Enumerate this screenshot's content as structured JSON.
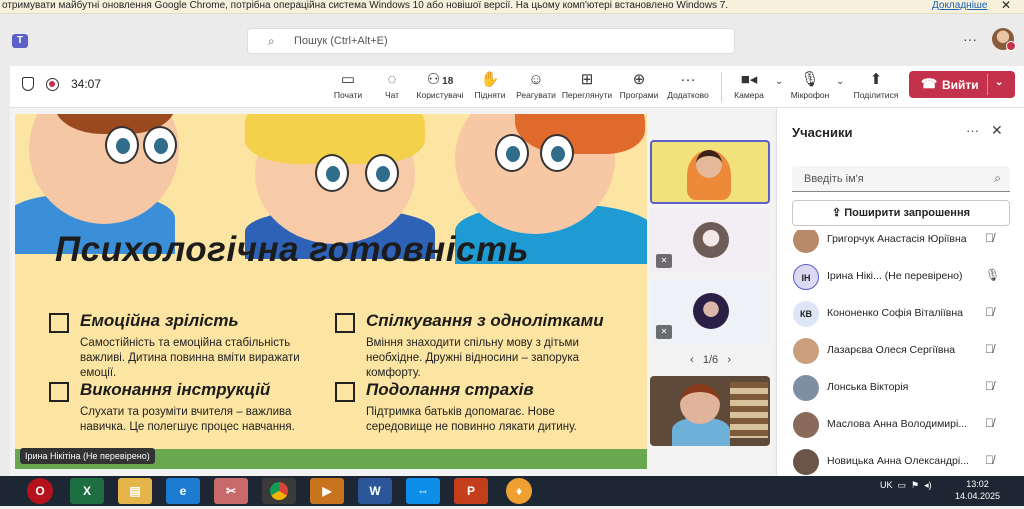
{
  "banner": {
    "text": "отримувати майбутні оновлення Google Chrome, потрібна операційна система Windows 10 або новішої версії. На цьому комп'ютері встановлено Windows 7.",
    "more": "Докладніше",
    "close": "✕"
  },
  "topbar": {
    "search_placeholder": "Пошук (Ctrl+Alt+E)",
    "menu": "···"
  },
  "call": {
    "timer": "34:07",
    "leave_label": "Вийти"
  },
  "toolbar": {
    "start": "Почати",
    "chat": "Чат",
    "people": "Користувачі",
    "people_count": "18",
    "raise": "Підняти",
    "react": "Реагувати",
    "view": "Переглянути",
    "apps": "Програми",
    "more": "Додатково",
    "camera": "Камера",
    "mic": "Мікрофон",
    "share": "Поділитися"
  },
  "slide": {
    "title": "Психологічна готовність",
    "items": [
      {
        "heading": "Емоційна зрілість",
        "text": "Самостійність та емоційна стабільність важливі. Дитина повинна вміти виражати емоції."
      },
      {
        "heading": "Спілкування з однолітками",
        "text": "Вміння знаходити спільну мову з дітьми необхідне. Дружні відносини – запорука комфорту."
      },
      {
        "heading": "Виконання інструкцій",
        "text": "Слухати та розуміти вчителя – важлива навичка. Це полегшує процес навчання."
      },
      {
        "heading": "Подолання страхів",
        "text": "Підтримка батьків допомагає. Нове середовище не повинно лякати дитину."
      }
    ],
    "presenter": "Ірина Нікітіна (Не перевірено)"
  },
  "gallery": {
    "pager": "1/6"
  },
  "panel": {
    "title": "Учасники",
    "search_placeholder": "Введіть ім'я",
    "invite": "Поширити запрошення",
    "participants": [
      {
        "name": "Григорчук Анастасія Юріївна",
        "initials": "",
        "muted": true,
        "color": "#b98a6a"
      },
      {
        "name": "Ірина Нікі...  (Не перевірено)",
        "initials": "ІН",
        "muted": false,
        "color": "#dcd9f3"
      },
      {
        "name": "Кононенко Софія Віталіївна",
        "initials": "КВ",
        "muted": true,
        "color": "#dde6f7"
      },
      {
        "name": "Лазарєва Олеся Сергіївна",
        "initials": "",
        "muted": true,
        "color": "#caa07c"
      },
      {
        "name": "Лонська Вікторія",
        "initials": "",
        "muted": true,
        "color": "#7d8fa3"
      },
      {
        "name": "Маслова Анна Володимирі...",
        "initials": "",
        "muted": true,
        "color": "#8a6a5a"
      },
      {
        "name": "Новицька Анна Олександрі...",
        "initials": "",
        "muted": true,
        "color": "#6a5548"
      }
    ]
  },
  "taskbar": {
    "lang": "UK",
    "time": "13:02",
    "date": "14.04.2025"
  }
}
